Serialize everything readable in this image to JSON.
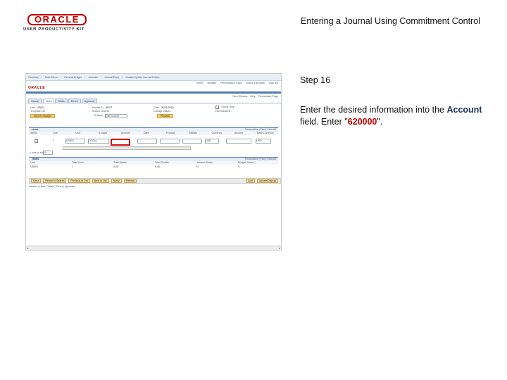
{
  "slide": {
    "logo_top": "ORACLE",
    "logo_bottom": "USER PRODUCTIVITY KIT",
    "title": "Entering a Journal Using Commitment Control",
    "step": "Step 16",
    "instruction": {
      "prefix": "Enter the desired information into the ",
      "field": "Account",
      "middle": " field. Enter \"",
      "value": "620000",
      "suffix": "\"."
    }
  },
  "app": {
    "nav": [
      "Favorites",
      "Main Menu",
      "General Ledger",
      "Journals",
      "Journal Entry",
      "Create/Update Journal Entries"
    ],
    "topright": [
      "Home",
      "Worklist",
      "Performance Trace",
      "Add to Favorites",
      "Sign out"
    ],
    "mini_logo": "ORACLE",
    "pagelinks": [
      "New Window",
      "Help",
      "Personalize Page"
    ],
    "tabs": [
      {
        "label": "Header",
        "active": false
      },
      {
        "label": "Lines",
        "active": true
      },
      {
        "label": "Totals",
        "active": false
      },
      {
        "label": "Errors",
        "active": false
      },
      {
        "label": "Approval",
        "active": false
      }
    ],
    "header_fields": [
      {
        "label": "Unit",
        "value": "US001"
      },
      {
        "label": "Journal ID",
        "value": "NEXT"
      },
      {
        "label": "Date",
        "value": "05/21/2015"
      },
      {
        "label": "Errors Only",
        "value": ""
      }
    ],
    "header_row2": [
      {
        "label": "Template List",
        "value": ""
      },
      {
        "label": "Search Criteria",
        "value": ""
      },
      {
        "label": "Change Values",
        "value": ""
      },
      {
        "label": "Inter/IntraUnit",
        "value": ""
      }
    ],
    "process_button": "Send to Budget",
    "process_label": "Process",
    "process_select": "Edit Journal",
    "process_go": "Process",
    "lines_grid": {
      "title": "Lines",
      "controls": "Personalize | Find | View All",
      "columns": [
        "Select",
        "Line",
        "Unit",
        "*Ledger",
        "Account",
        "Dept",
        "Product",
        "Affiliate",
        "Currency",
        "Amount",
        "Base Currency"
      ],
      "row": [
        "",
        "1",
        "US001",
        "LOCAL",
        "",
        "",
        "",
        "",
        "USD",
        "",
        "USD"
      ]
    },
    "lines_to_add_label": "Lines to add",
    "lines_to_add_value": "10",
    "totals_grid": {
      "title": "Totals",
      "controls": "Personalize | Find | View All",
      "columns": [
        "Unit",
        "Total Lines",
        "Total Debits",
        "Total Credits",
        "Journal Status",
        "Budget Status"
      ],
      "row": [
        "US001",
        "1",
        "0.00",
        "0.00",
        "N",
        "V"
      ]
    },
    "toolbar": [
      "Save",
      "Return to Search",
      "Previous in List",
      "Next in List",
      "Notify",
      "Refresh",
      "Add",
      "Update/Display"
    ],
    "footer_links": "Header | Lines | Totals | Errors | Approval"
  }
}
